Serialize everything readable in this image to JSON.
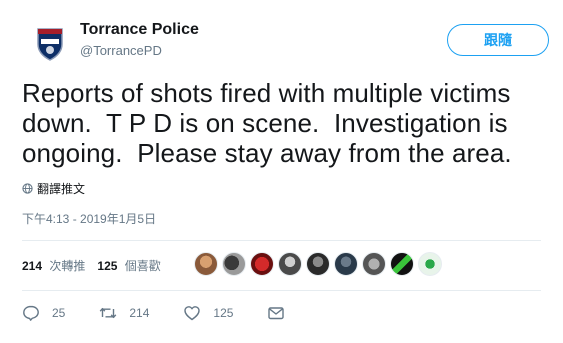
{
  "author": {
    "name": "Torrance Police",
    "handle": "@TorrancePD"
  },
  "follow_label": "跟隨",
  "tweet": {
    "text": "Reports of shots fired with multiple victims down.  T P D is on scene.  Investigation is ongoing.  Please stay away from the area."
  },
  "translate_label": "翻譯推文",
  "timestamp": "下午4:13 - 2019年1月5日",
  "stats": {
    "retweets_count": "214",
    "retweets_label": "次轉推",
    "likes_count": "125",
    "likes_label": "個喜歡"
  },
  "actions": {
    "reply_count": "25",
    "retweet_count": "214",
    "like_count": "125"
  },
  "icons": {
    "globe": "globe-icon",
    "reply": "reply-icon",
    "retweet": "retweet-icon",
    "like": "heart-icon",
    "message": "envelope-icon"
  },
  "colors": {
    "accent": "#1da1f2",
    "text": "#14171a",
    "muted": "#657786",
    "divider": "#e6ecf0"
  }
}
